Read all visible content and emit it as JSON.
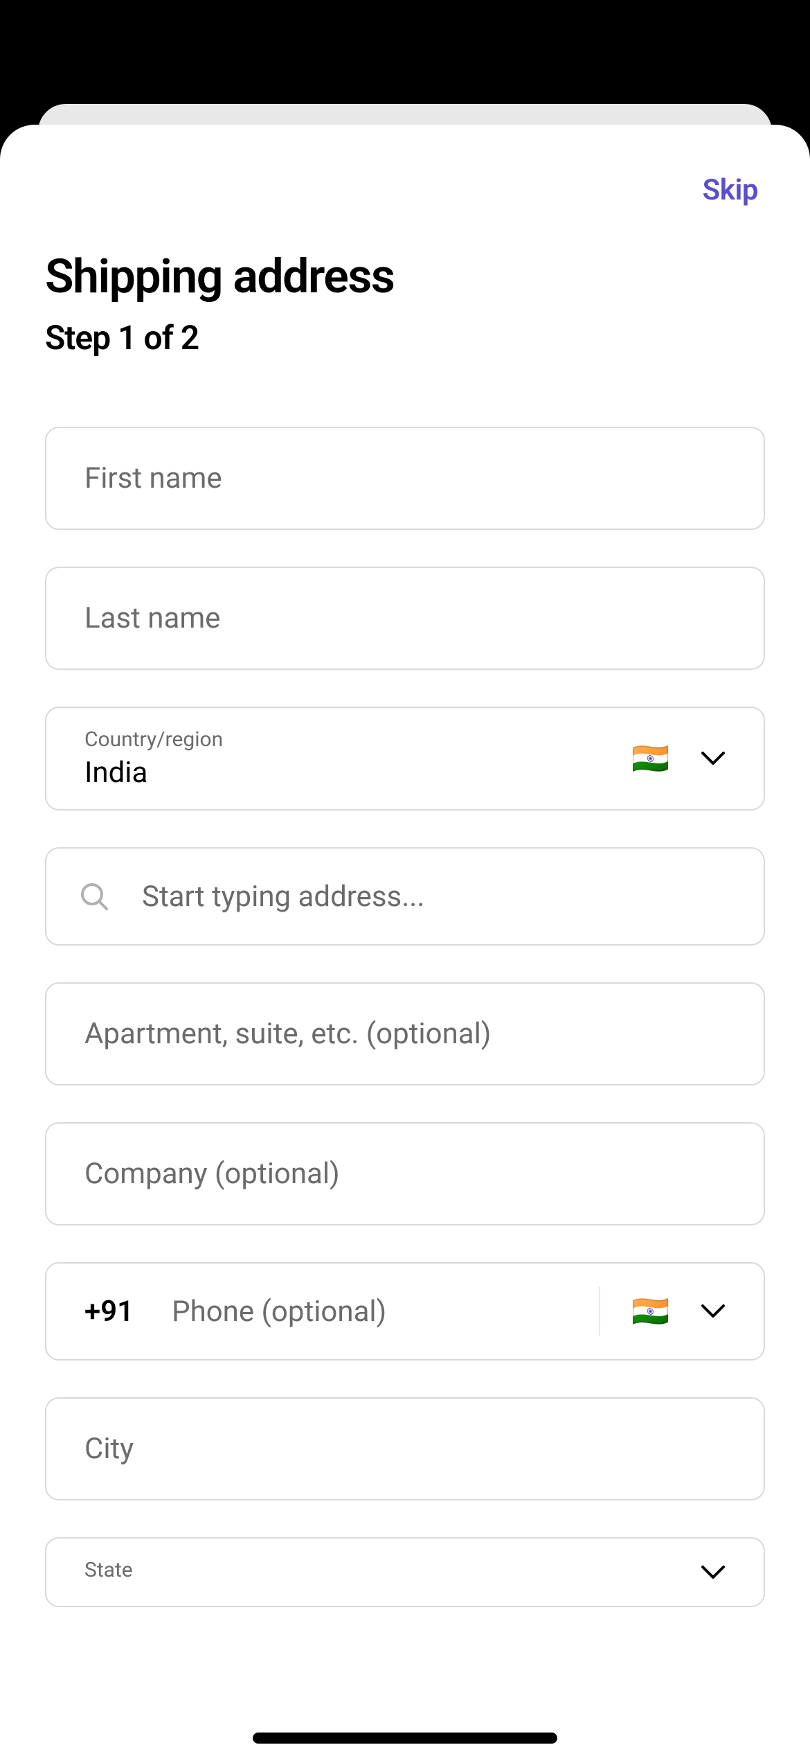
{
  "header": {
    "skip_label": "Skip",
    "title": "Shipping address",
    "subtitle": "Step 1 of 2"
  },
  "form": {
    "first_name": {
      "placeholder": "First name",
      "value": ""
    },
    "last_name": {
      "placeholder": "Last name",
      "value": ""
    },
    "country": {
      "label": "Country/region",
      "value": "India",
      "flag": "🇮🇳"
    },
    "address_search": {
      "placeholder": "Start typing address...",
      "value": ""
    },
    "apartment": {
      "placeholder": "Apartment, suite, etc. (optional)",
      "value": ""
    },
    "company": {
      "placeholder": "Company (optional)",
      "value": ""
    },
    "phone": {
      "prefix": "+91",
      "placeholder": "Phone (optional)",
      "value": "",
      "flag": "🇮🇳"
    },
    "city": {
      "placeholder": "City",
      "value": ""
    },
    "state": {
      "label": "State",
      "value": ""
    }
  }
}
